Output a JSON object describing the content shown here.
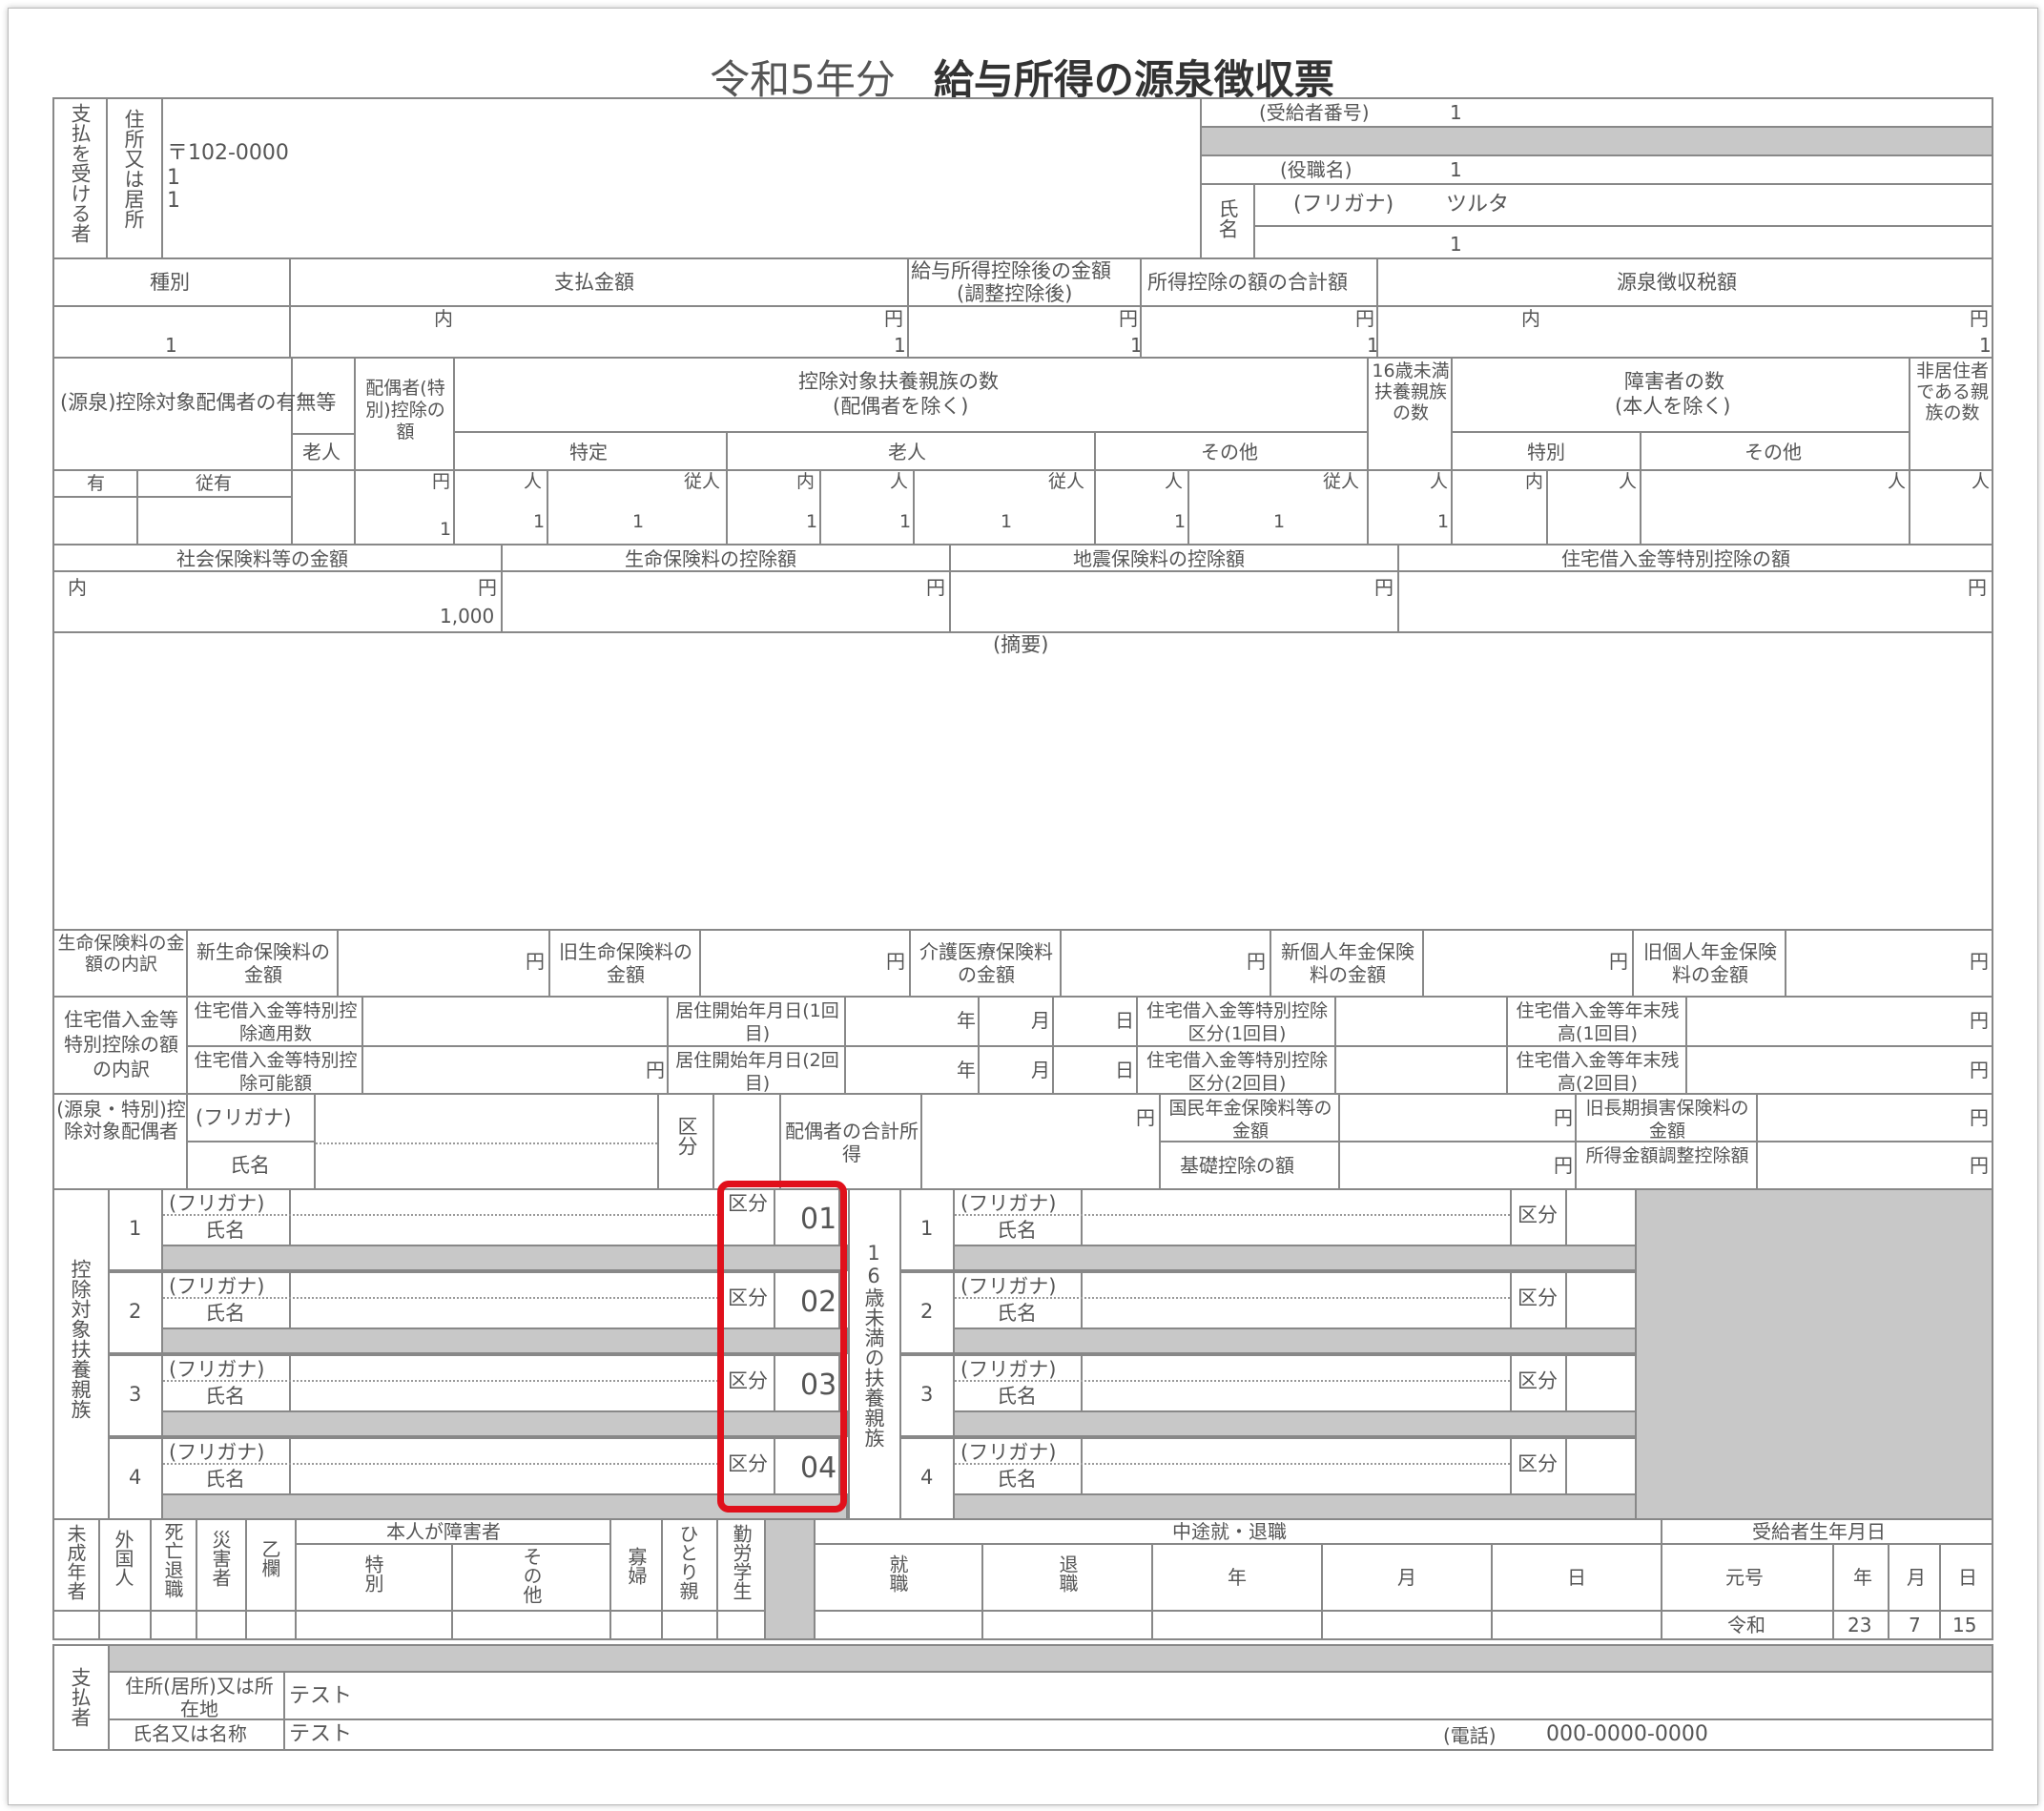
{
  "title": {
    "year": "令和5年分",
    "name": "給与所得の源泉徴収票"
  },
  "recipient": {
    "side_label": "支払を受ける者",
    "address_label": "住所又は居所",
    "postal": "〒102-0000",
    "addr1": "1",
    "addr2": "1",
    "number_label": "(受給者番号)",
    "number": "1",
    "position_label": "(役職名)",
    "position": "1",
    "name_label": "氏名",
    "furigana_label": "(フリガナ)",
    "furigana": "ツルタ",
    "name": "1"
  },
  "payment": {
    "type_label": "種別",
    "amount_label": "支払金額",
    "after_label": "給与所得控除後の金額",
    "after_sub": "(調整控除後)",
    "deduct_label": "所得控除の額の合計額",
    "tax_label": "源泉徴収税額",
    "type": "1",
    "uchi": "内",
    "yen": "円",
    "amount": "1",
    "after": "1",
    "deduct": "1",
    "tax": "1"
  },
  "dependents": {
    "spouse_label": "(源泉)控除対象配偶者の有無等",
    "spouse_yes": "有",
    "spouse_ju": "従有",
    "rojin": "老人",
    "spouse_deduct_label": "配偶者(特別)控除の額",
    "spouse_deduct": "1",
    "dep_label": "控除対象扶養親族の数",
    "dep_sub": "(配偶者を除く)",
    "tokutei": "特定",
    "sonota": "その他",
    "under16_label": "16歳未満扶養親族の数",
    "disabled_label": "障害者の数",
    "disabled_sub": "(本人を除く)",
    "tokubetsu": "特別",
    "nonres_label": "非居住者である親族の数",
    "nin": "人",
    "ju": "従人",
    "v_tokutei": "1",
    "v_tokutei_ju": "1",
    "v_rojin_uchi": "1",
    "v_rojin": "1",
    "v_rojin_ju": "1",
    "v_other": "1",
    "v_other_ju": "1",
    "v_under16": "1"
  },
  "insurance": {
    "social_label": "社会保険料等の金額",
    "life_label": "生命保険料の控除額",
    "quake_label": "地震保険料の控除額",
    "housing_label": "住宅借入金等特別控除の額",
    "social": "1,000",
    "summary_label": "(摘要)"
  },
  "life_detail": {
    "label": "生命保険料の金額の内訳",
    "new_life": "新生命保険料の金額",
    "old_life": "旧生命保険料の金額",
    "care": "介護医療保険料の金額",
    "new_pension": "新個人年金保険料の金額",
    "old_pension": "旧個人年金保険料の金額"
  },
  "housing": {
    "label": "住宅借入金等特別控除の額の内訳",
    "count": "住宅借入金等特別控除適用数",
    "possible": "住宅借入金等特別控除可能額",
    "start1": "居住開始年月日(1回目)",
    "start2": "居住開始年月日(2回目)",
    "nen": "年",
    "tsuki": "月",
    "nichi": "日",
    "kubun1": "住宅借入金等特別控除区分(1回目)",
    "kubun2": "住宅借入金等特別控除区分(2回目)",
    "balance1": "住宅借入金等年末残高(1回目)",
    "balance2": "住宅借入金等年末残高(2回目)"
  },
  "spouse_detail": {
    "label": "(源泉・特別)控除対象配偶者",
    "furigana": "(フリガナ)",
    "name": "氏名",
    "kubun": "区分",
    "income": "配偶者の合計所得",
    "pension": "国民年金保険料等の金額",
    "basic": "基礎控除の額",
    "longterm": "旧長期損害保険料の金額",
    "adjust": "所得金額調整控除額"
  },
  "dependent_list": {
    "label": "控除対象扶養親族",
    "under16_label": "16歳未満の扶養親族",
    "furigana": "(フリガナ)",
    "name": "氏名",
    "kubun": "区分",
    "rows": [
      {
        "no": "1",
        "code": "01"
      },
      {
        "no": "2",
        "code": "02"
      },
      {
        "no": "3",
        "code": "03"
      },
      {
        "no": "4",
        "code": "04"
      }
    ]
  },
  "status": {
    "minor": "未成年者",
    "foreign": "外国人",
    "death": "死亡退職",
    "disaster": "災害者",
    "otsu": "乙欄",
    "disabled": "本人が障害者",
    "special": "特別",
    "other": "その他",
    "widow": "寡婦",
    "single": "ひとり親",
    "student": "勤労学生",
    "midway": "中途就・退職",
    "hire": "就職",
    "retire": "退職",
    "nen": "年",
    "tsuki": "月",
    "nichi": "日",
    "birth": "受給者生年月日",
    "era_label": "元号",
    "era": "令和",
    "birth_year": "23",
    "birth_month": "7",
    "birth_day": "15"
  },
  "payer": {
    "side_label": "支払者",
    "address_label": "住所(居所)又は所在地",
    "address": "テスト",
    "name_label": "氏名又は名称",
    "name": "テスト",
    "phone_label": "(電話)",
    "phone": "000-0000-0000"
  },
  "colors": {
    "highlight": "#e0101b",
    "grey": "#c8c8c8",
    "line": "#888888"
  }
}
